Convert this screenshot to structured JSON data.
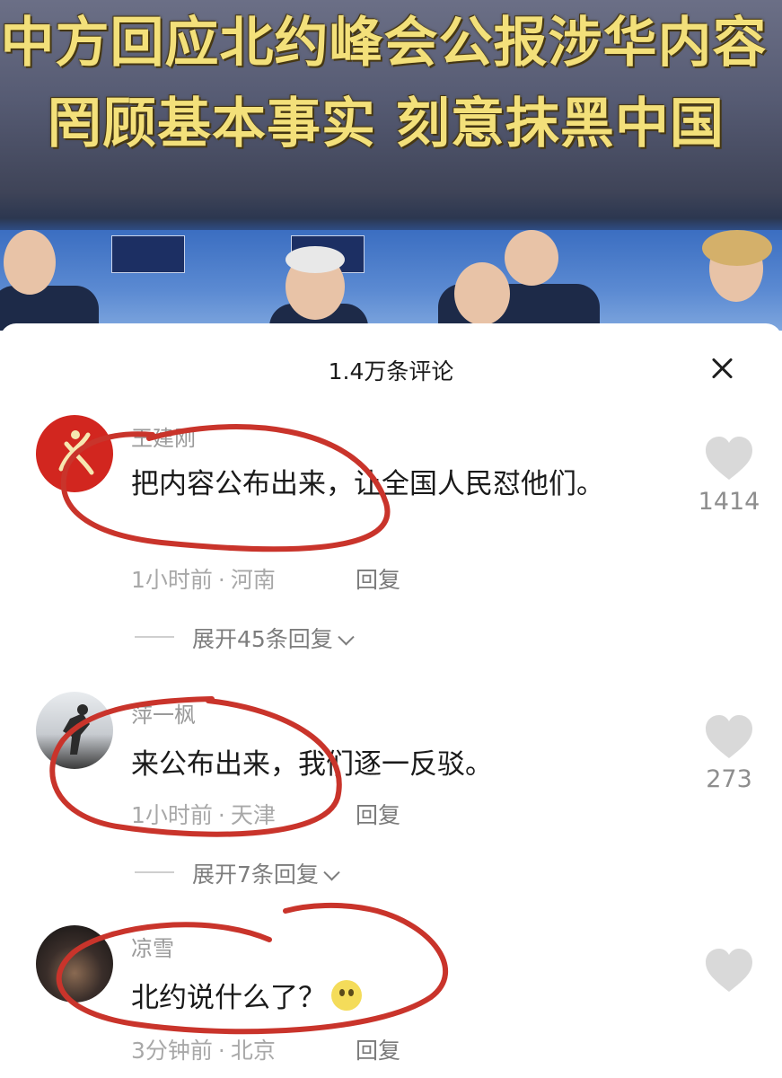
{
  "video": {
    "headline_line1": "中方回应北约峰会公报涉华内容",
    "headline_line2": "罔顾基本事实 刻意抹黑中国"
  },
  "comments_panel": {
    "title": "1.4万条评论",
    "close_icon": "close-icon",
    "comments": [
      {
        "username": "王建刚",
        "text": "把内容公布出来，让全国人民怼他们。",
        "time": "1小时前",
        "location": "河南",
        "reply_label": "回复",
        "likes": "1414",
        "expand_label": "展开45条回复"
      },
      {
        "username": "萍一枫",
        "text": "来公布出来，我们逐一反驳。",
        "time": "1小时前",
        "location": "天津",
        "reply_label": "回复",
        "likes": "273",
        "expand_label": "展开7条回复"
      },
      {
        "username": "凉雪",
        "text": "北约说什么了？",
        "time": "3分钟前",
        "location": "北京",
        "reply_label": "回复",
        "likes": "",
        "expand_label": ""
      }
    ]
  },
  "colors": {
    "headline": "#f3e07a",
    "annotation_red": "#c9342b",
    "like_grey": "#d9d9d9"
  }
}
